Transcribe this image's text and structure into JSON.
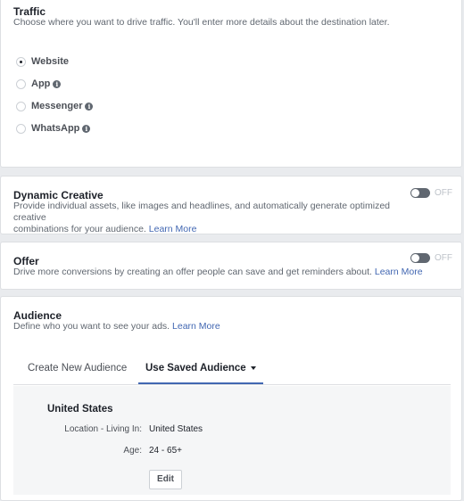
{
  "traffic": {
    "title": "Traffic",
    "description": "Choose where you want to drive traffic. You'll enter more details about the destination later.",
    "options": [
      {
        "label": "Website",
        "checked": true,
        "info": false
      },
      {
        "label": "App",
        "checked": false,
        "info": true
      },
      {
        "label": "Messenger",
        "checked": false,
        "info": true
      },
      {
        "label": "WhatsApp",
        "checked": false,
        "info": true
      }
    ]
  },
  "dynamic_creative": {
    "title": "Dynamic Creative",
    "description": "Provide individual assets, like images and headlines, and automatically generate optimized creative",
    "description_line2": "combinations for your audience.",
    "learn_more": "Learn More",
    "toggle_state": "OFF"
  },
  "offer": {
    "title": "Offer",
    "description": "Drive more conversions by creating an offer people can save and get reminders about.",
    "learn_more": "Learn More",
    "toggle_state": "OFF"
  },
  "audience": {
    "title": "Audience",
    "description": "Define who you want to see your ads.",
    "learn_more": "Learn More",
    "tabs": {
      "create_new": "Create New Audience",
      "use_saved": "Use Saved Audience"
    },
    "saved": {
      "name": "United States",
      "location_label": "Location - Living In:",
      "location_value": "United States",
      "age_label": "Age:",
      "age_value": "24 - 65+",
      "edit_label": "Edit"
    }
  },
  "colors": {
    "link": "#4267b2",
    "toggle_off": "#606770",
    "background": "#e9ebee"
  }
}
